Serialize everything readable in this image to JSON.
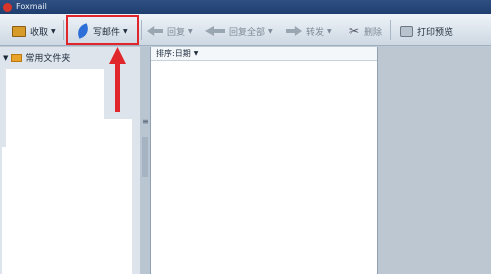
{
  "app": {
    "title": "Foxmail"
  },
  "toolbar": {
    "receive_label": "收取",
    "compose_label": "写邮件",
    "reply_label": "回复",
    "reply_all_label": "回复全部",
    "forward_label": "转发",
    "delete_label": "删除",
    "print_preview_label": "打印预览"
  },
  "sidebar": {
    "folder_group_label": "常用文件夹"
  },
  "mail_list": {
    "sort_label": "排序:日期"
  },
  "annotation": {
    "highlight_color": "#e0262a"
  }
}
